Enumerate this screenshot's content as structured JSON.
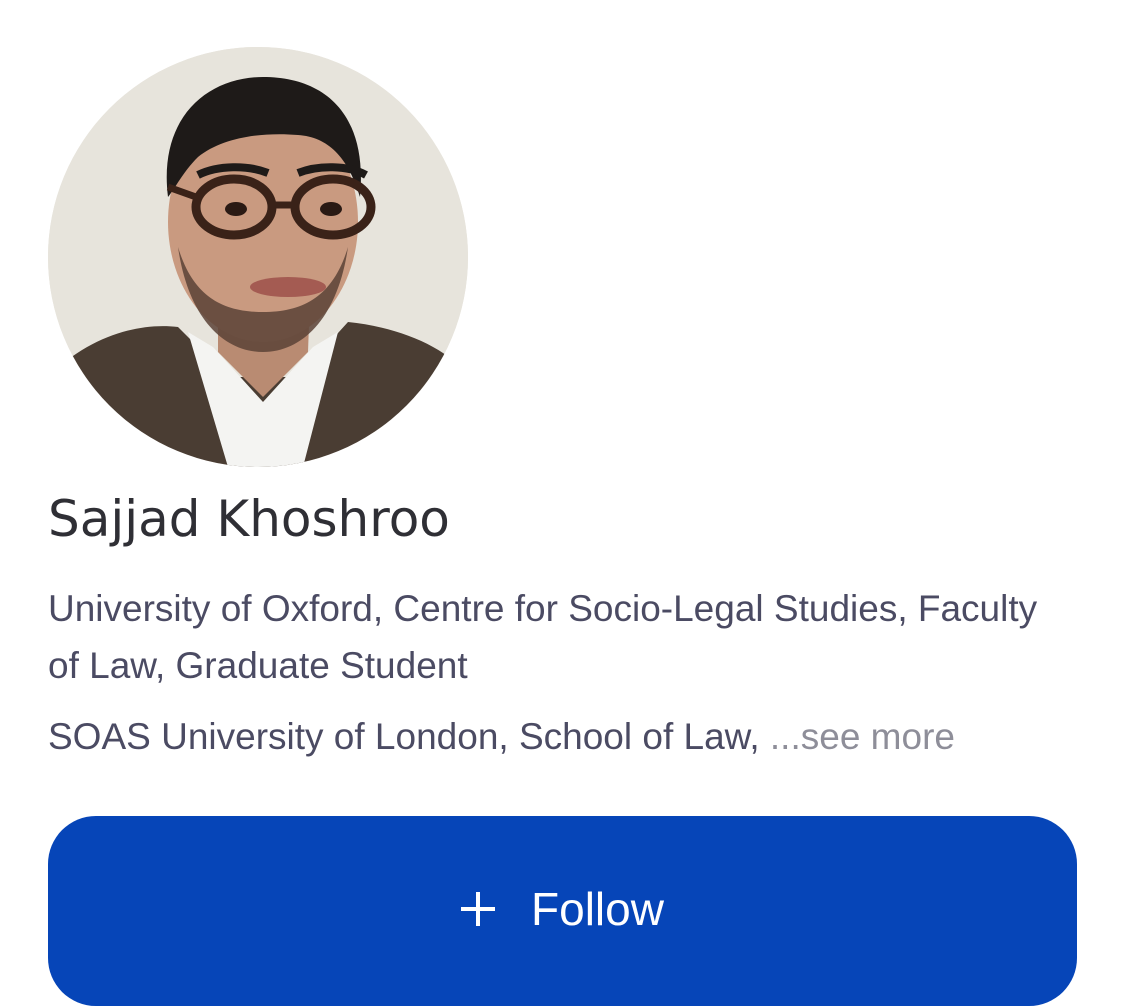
{
  "profile": {
    "name": "Sajjad Khoshroo",
    "affiliation_primary": "University of Oxford, Centre for Socio-Legal Studies, Faculty of Law, Graduate Student",
    "affiliation_secondary": "SOAS University of London, School of Law,",
    "see_more_label": "...see more",
    "avatar_icon": "profile-photo"
  },
  "actions": {
    "follow_icon": "plus-icon",
    "follow_label": "Follow"
  },
  "colors": {
    "accent": "#0645b8",
    "name_text": "#2f2f35",
    "secondary_text": "#4b4b63",
    "muted_text": "#8e8e99",
    "background": "#ffffff"
  }
}
